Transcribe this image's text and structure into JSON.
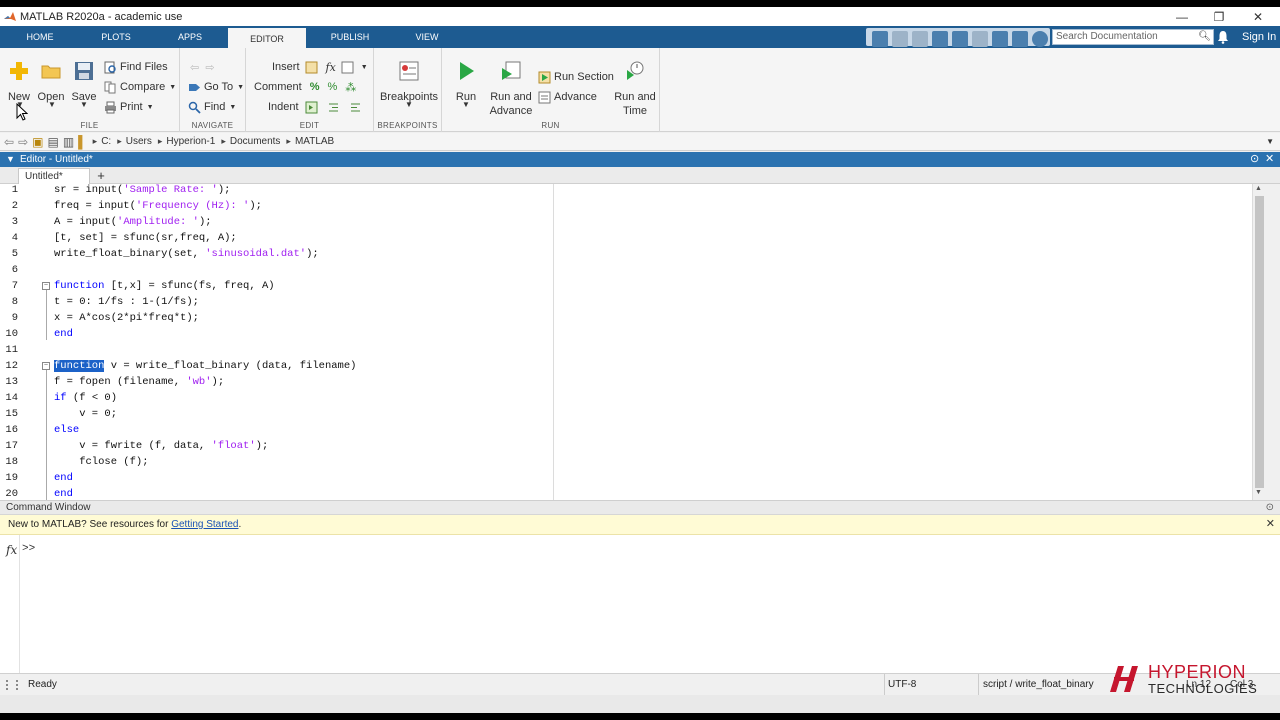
{
  "window": {
    "title": "MATLAB R2020a - academic use",
    "minimize": "—",
    "maximize": "❐",
    "close": "✕"
  },
  "tabs": [
    {
      "label": "HOME"
    },
    {
      "label": "PLOTS"
    },
    {
      "label": "APPS"
    },
    {
      "label": "EDITOR"
    },
    {
      "label": "PUBLISH"
    },
    {
      "label": "VIEW"
    }
  ],
  "search": {
    "placeholder": "Search Documentation"
  },
  "signin": "Sign In",
  "ribbon": {
    "file": {
      "group_label": "FILE",
      "new": "New",
      "open": "Open",
      "save": "Save",
      "find_files": "Find Files",
      "compare": "Compare",
      "print": "Print"
    },
    "navigate": {
      "group_label": "NAVIGATE",
      "go_to": "Go To",
      "find": "Find"
    },
    "edit": {
      "group_label": "EDIT",
      "insert": "Insert",
      "comment": "Comment",
      "indent": "Indent"
    },
    "breakpoints": {
      "group_label": "BREAKPOINTS",
      "breakpoints": "Breakpoints"
    },
    "run": {
      "group_label": "RUN",
      "run": "Run",
      "run_and_advance_1": "Run and",
      "run_and_advance_2": "Advance",
      "run_section": "Run Section",
      "advance": "Advance",
      "run_and_time_1": "Run and",
      "run_and_time_2": "Time"
    }
  },
  "path": [
    "C:",
    "Users",
    "Hyperion-1",
    "Documents",
    "MATLAB"
  ],
  "editor": {
    "header": "Editor - Untitled*",
    "file_tab": "Untitled*",
    "add_tab": "+",
    "lines": [
      {
        "n": "1",
        "code": "sr = input('Sample Rate: ');"
      },
      {
        "n": "2",
        "code": "freq = input('Frequency (Hz): ');"
      },
      {
        "n": "3",
        "code": "A = input('Amplitude: ');"
      },
      {
        "n": "4",
        "code": "[t, set] = sfunc(sr,freq, A);"
      },
      {
        "n": "5",
        "code": "write_float_binary(set, 'sinusoidal.dat');"
      },
      {
        "n": "6",
        "code": ""
      },
      {
        "n": "7",
        "code": "function [t,x] = sfunc(fs, freq, A)"
      },
      {
        "n": "8",
        "code": "t = 0: 1/fs : 1-(1/fs);"
      },
      {
        "n": "9",
        "code": "x = A*cos(2*pi*freq*t);"
      },
      {
        "n": "10",
        "code": "end"
      },
      {
        "n": "11",
        "code": ""
      },
      {
        "n": "12",
        "code": "function v = write_float_binary (data, filename)"
      },
      {
        "n": "13",
        "code": "f = fopen (filename, 'wb');"
      },
      {
        "n": "14",
        "code": "if (f < 0)"
      },
      {
        "n": "15",
        "code": "    v = 0;"
      },
      {
        "n": "16",
        "code": "else"
      },
      {
        "n": "17",
        "code": "    v = fwrite (f, data, 'float');"
      },
      {
        "n": "18",
        "code": "    fclose (f);"
      },
      {
        "n": "19",
        "code": "end"
      },
      {
        "n": "20",
        "code": "end"
      }
    ]
  },
  "command_window": {
    "title": "Command Window",
    "banner_text": "New to MATLAB? See resources for ",
    "banner_link": "Getting Started",
    "banner_end": ".",
    "prompt": ">>",
    "fx": "fx"
  },
  "status": {
    "state": "Ready",
    "encoding": "UTF-8",
    "scope": "script / write_float_binary",
    "ln_label": "Ln 12",
    "col_label": "Col 3"
  },
  "watermark": {
    "line1": "HYPERION",
    "line2": "TECHNOLOGIES"
  },
  "colors": {
    "tabstrip": "#1d5b91",
    "keyword": "#0000ff",
    "string": "#a020f0",
    "selection": "#1c62c8",
    "watermark_red": "#c5162e"
  }
}
